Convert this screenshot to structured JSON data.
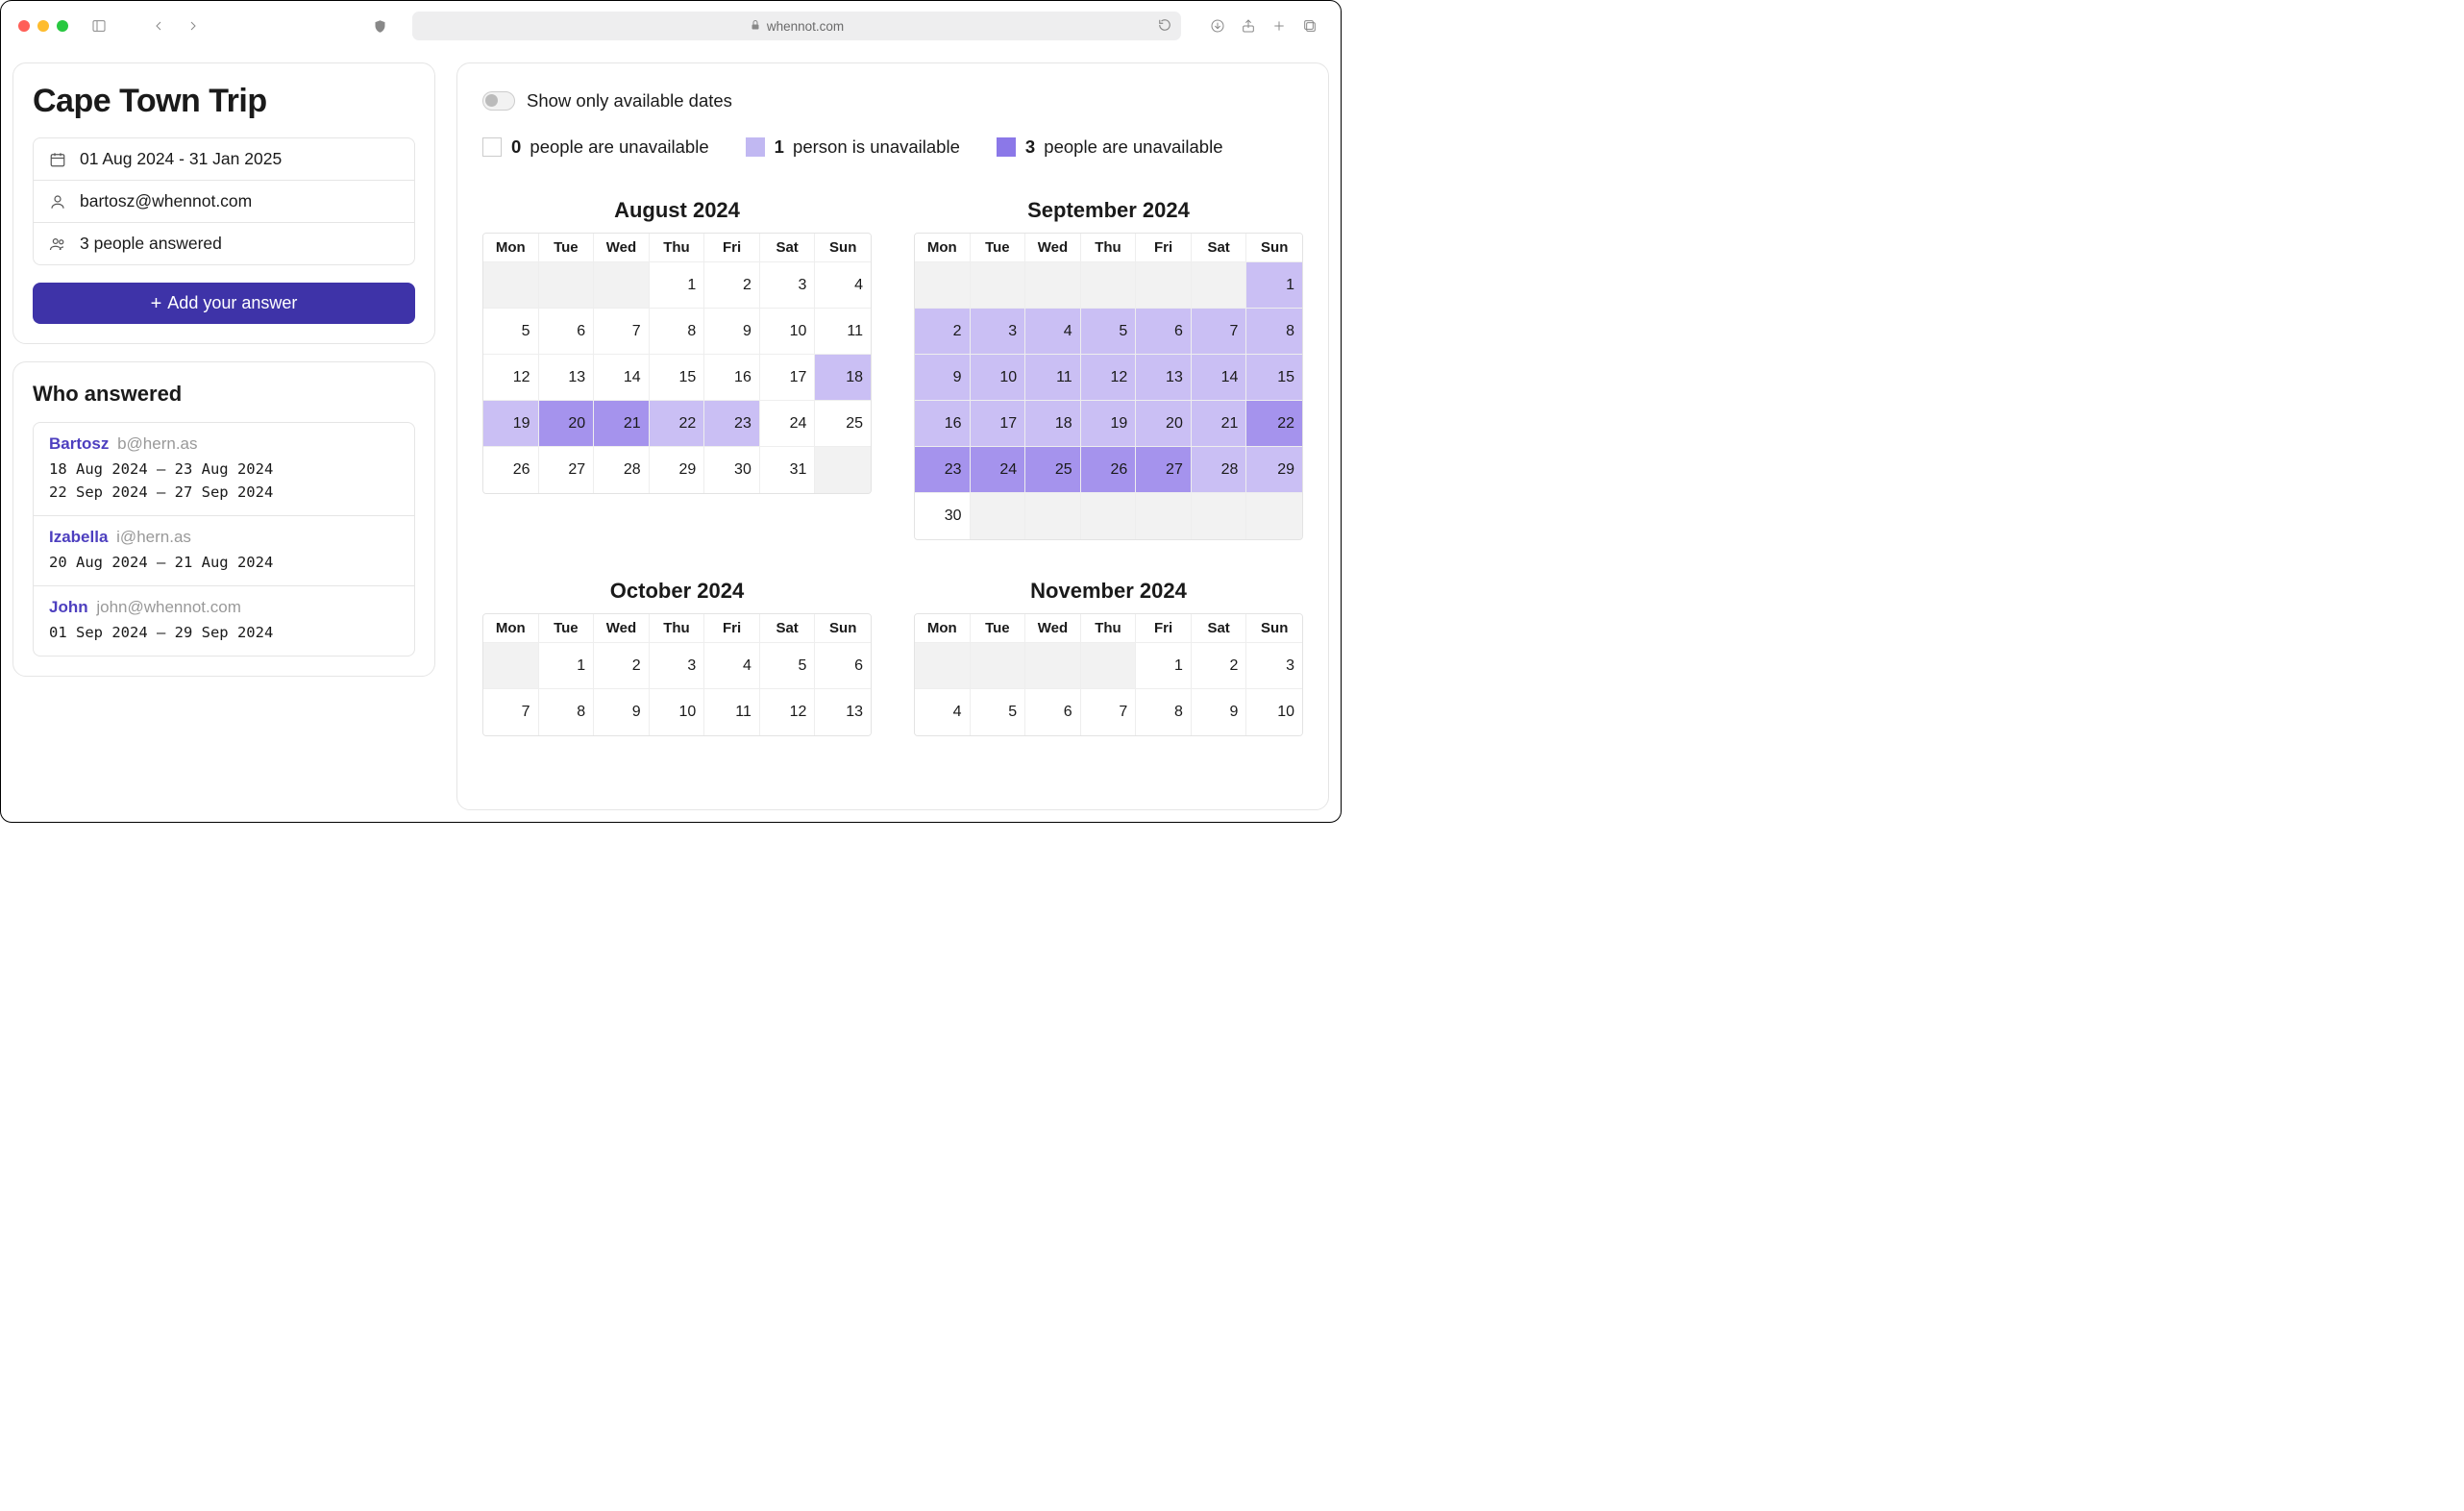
{
  "browser": {
    "url_host": "whennot.com"
  },
  "trip": {
    "title": "Cape Town Trip",
    "date_range": "01 Aug 2024 - 31 Jan 2025",
    "owner_email": "bartosz@whennot.com",
    "answered_count_text": "3 people answered",
    "add_button": "Add your answer"
  },
  "who": {
    "title": "Who answered",
    "answers": [
      {
        "name": "Bartosz",
        "email": "b@hern.as",
        "dates": "18 Aug 2024 – 23 Aug 2024\n22 Sep 2024 – 27 Sep 2024"
      },
      {
        "name": "Izabella",
        "email": "i@hern.as",
        "dates": "20 Aug 2024 – 21 Aug 2024"
      },
      {
        "name": "John",
        "email": "john@whennot.com",
        "dates": "01 Sep 2024 – 29 Sep 2024"
      }
    ]
  },
  "controls": {
    "toggle_label": "Show only available dates",
    "legend": [
      {
        "count": "0",
        "text": " people are unavailable",
        "swatch": "s0"
      },
      {
        "count": "1",
        "text": " person is unavailable",
        "swatch": "s1"
      },
      {
        "count": "3",
        "text": " people are unavailable",
        "swatch": "s3"
      }
    ]
  },
  "weekdays": [
    "Mon",
    "Tue",
    "Wed",
    "Thu",
    "Fri",
    "Sat",
    "Sun"
  ],
  "months": [
    {
      "title": "August 2024",
      "lead_pad": 3,
      "days": [
        {
          "n": 1,
          "lv": 0
        },
        {
          "n": 2,
          "lv": 0
        },
        {
          "n": 3,
          "lv": 0
        },
        {
          "n": 4,
          "lv": 0
        },
        {
          "n": 5,
          "lv": 0
        },
        {
          "n": 6,
          "lv": 0
        },
        {
          "n": 7,
          "lv": 0
        },
        {
          "n": 8,
          "lv": 0
        },
        {
          "n": 9,
          "lv": 0
        },
        {
          "n": 10,
          "lv": 0
        },
        {
          "n": 11,
          "lv": 0
        },
        {
          "n": 12,
          "lv": 0
        },
        {
          "n": 13,
          "lv": 0
        },
        {
          "n": 14,
          "lv": 0
        },
        {
          "n": 15,
          "lv": 0
        },
        {
          "n": 16,
          "lv": 0
        },
        {
          "n": 17,
          "lv": 0
        },
        {
          "n": 18,
          "lv": 1
        },
        {
          "n": 19,
          "lv": 1
        },
        {
          "n": 20,
          "lv": 2
        },
        {
          "n": 21,
          "lv": 2
        },
        {
          "n": 22,
          "lv": 1
        },
        {
          "n": 23,
          "lv": 1
        },
        {
          "n": 24,
          "lv": 0
        },
        {
          "n": 25,
          "lv": 0
        },
        {
          "n": 26,
          "lv": 0
        },
        {
          "n": 27,
          "lv": 0
        },
        {
          "n": 28,
          "lv": 0
        },
        {
          "n": 29,
          "lv": 0
        },
        {
          "n": 30,
          "lv": 0
        },
        {
          "n": 31,
          "lv": 0
        }
      ],
      "trail_pad": 1
    },
    {
      "title": "September 2024",
      "lead_pad": 6,
      "days": [
        {
          "n": 1,
          "lv": 1
        },
        {
          "n": 2,
          "lv": 1
        },
        {
          "n": 3,
          "lv": 1
        },
        {
          "n": 4,
          "lv": 1
        },
        {
          "n": 5,
          "lv": 1
        },
        {
          "n": 6,
          "lv": 1
        },
        {
          "n": 7,
          "lv": 1
        },
        {
          "n": 8,
          "lv": 1
        },
        {
          "n": 9,
          "lv": 1
        },
        {
          "n": 10,
          "lv": 1
        },
        {
          "n": 11,
          "lv": 1
        },
        {
          "n": 12,
          "lv": 1
        },
        {
          "n": 13,
          "lv": 1
        },
        {
          "n": 14,
          "lv": 1
        },
        {
          "n": 15,
          "lv": 1
        },
        {
          "n": 16,
          "lv": 1
        },
        {
          "n": 17,
          "lv": 1
        },
        {
          "n": 18,
          "lv": 1
        },
        {
          "n": 19,
          "lv": 1
        },
        {
          "n": 20,
          "lv": 1
        },
        {
          "n": 21,
          "lv": 1
        },
        {
          "n": 22,
          "lv": 2
        },
        {
          "n": 23,
          "lv": 2
        },
        {
          "n": 24,
          "lv": 2
        },
        {
          "n": 25,
          "lv": 2
        },
        {
          "n": 26,
          "lv": 2
        },
        {
          "n": 27,
          "lv": 2
        },
        {
          "n": 28,
          "lv": 1
        },
        {
          "n": 29,
          "lv": 1
        },
        {
          "n": 30,
          "lv": 0
        }
      ],
      "trail_pad": 6
    },
    {
      "title": "October 2024",
      "lead_pad": 1,
      "days": [
        {
          "n": 1,
          "lv": 0
        },
        {
          "n": 2,
          "lv": 0
        },
        {
          "n": 3,
          "lv": 0
        },
        {
          "n": 4,
          "lv": 0
        },
        {
          "n": 5,
          "lv": 0
        },
        {
          "n": 6,
          "lv": 0
        },
        {
          "n": 7,
          "lv": 0
        },
        {
          "n": 8,
          "lv": 0
        },
        {
          "n": 9,
          "lv": 0
        },
        {
          "n": 10,
          "lv": 0
        },
        {
          "n": 11,
          "lv": 0
        },
        {
          "n": 12,
          "lv": 0
        },
        {
          "n": 13,
          "lv": 0
        }
      ],
      "trail_pad": 0
    },
    {
      "title": "November 2024",
      "lead_pad": 4,
      "days": [
        {
          "n": 1,
          "lv": 0
        },
        {
          "n": 2,
          "lv": 0
        },
        {
          "n": 3,
          "lv": 0
        },
        {
          "n": 4,
          "lv": 0
        },
        {
          "n": 5,
          "lv": 0
        },
        {
          "n": 6,
          "lv": 0
        },
        {
          "n": 7,
          "lv": 0
        },
        {
          "n": 8,
          "lv": 0
        },
        {
          "n": 9,
          "lv": 0
        },
        {
          "n": 10,
          "lv": 0
        }
      ],
      "trail_pad": 0
    }
  ]
}
